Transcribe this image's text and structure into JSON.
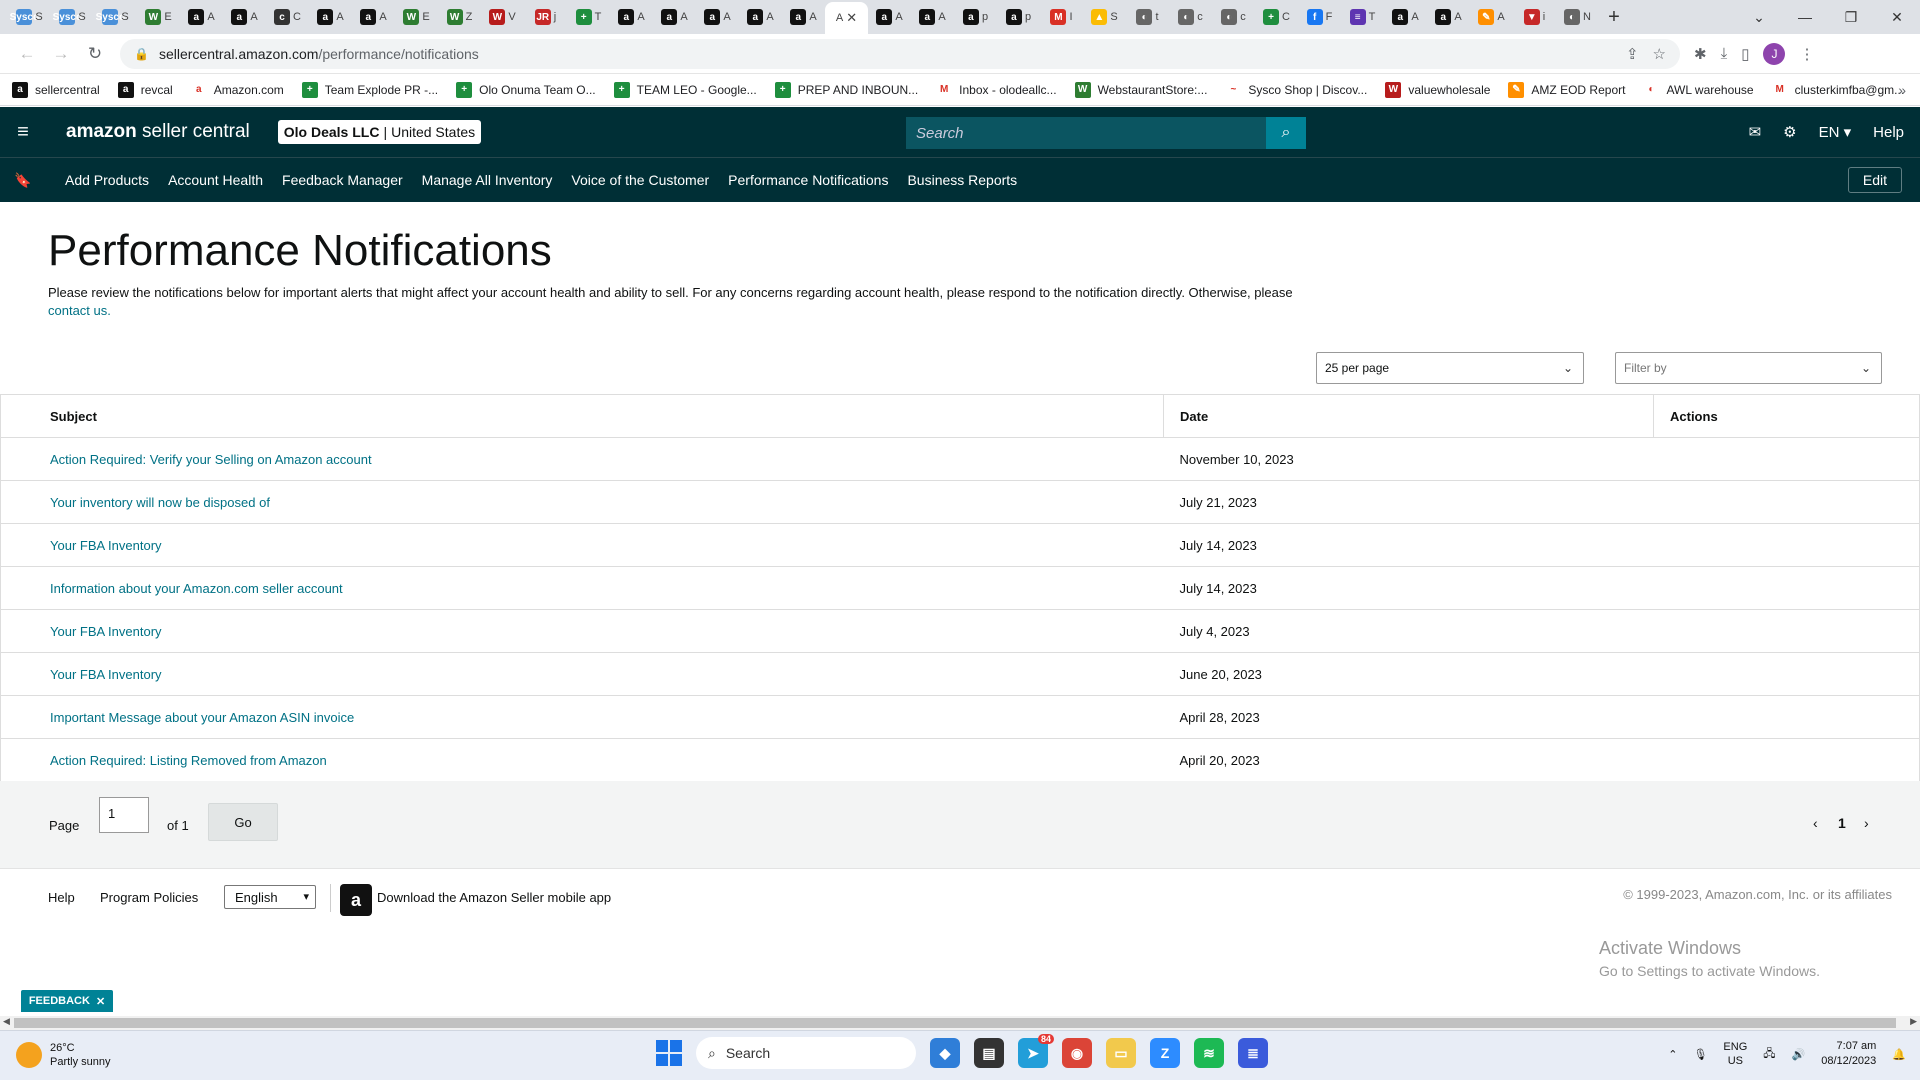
{
  "browser": {
    "tabs": [
      {
        "label": "S",
        "color": "#4a90d9",
        "icon_text": "Sysco"
      },
      {
        "label": "S",
        "color": "#4a90d9",
        "icon_text": "Sysco"
      },
      {
        "label": "S",
        "color": "#4a90d9",
        "icon_text": "Sysco"
      },
      {
        "label": "E",
        "color": "#2e7d32",
        "icon_text": "W"
      },
      {
        "label": "A",
        "color": "#111111",
        "icon_text": "a"
      },
      {
        "label": "A",
        "color": "#111111",
        "icon_text": "a"
      },
      {
        "label": "C",
        "color": "#333333",
        "icon_text": "c"
      },
      {
        "label": "A",
        "color": "#111111",
        "icon_text": "a"
      },
      {
        "label": "A",
        "color": "#111111",
        "icon_text": "a"
      },
      {
        "label": "E",
        "color": "#2e7d32",
        "icon_text": "W"
      },
      {
        "label": "Z",
        "color": "#2e7d32",
        "icon_text": "W"
      },
      {
        "label": "V",
        "color": "#b71c1c",
        "icon_text": "W"
      },
      {
        "label": "j",
        "color": "#c62828",
        "icon_text": "JR"
      },
      {
        "label": "T",
        "color": "#1e8e3e",
        "icon_text": "+"
      },
      {
        "label": "A",
        "color": "#111111",
        "icon_text": "a"
      },
      {
        "label": "A",
        "color": "#111111",
        "icon_text": "a"
      },
      {
        "label": "A",
        "color": "#111111",
        "icon_text": "a"
      },
      {
        "label": "A",
        "color": "#111111",
        "icon_text": "a"
      },
      {
        "label": "A",
        "color": "#111111",
        "icon_text": "a"
      }
    ],
    "active_tab_label": "A",
    "tabs_after": [
      {
        "label": "A",
        "color": "#111111",
        "icon_text": "a"
      },
      {
        "label": "A",
        "color": "#111111",
        "icon_text": "a"
      },
      {
        "label": "p",
        "color": "#111111",
        "icon_text": "a"
      },
      {
        "label": "p",
        "color": "#111111",
        "icon_text": "a"
      },
      {
        "label": "I",
        "color": "#d93025",
        "icon_text": "M"
      },
      {
        "label": "S",
        "color": "#fbbc04",
        "icon_text": "▲"
      },
      {
        "label": "t",
        "color": "#666666",
        "icon_text": "◐"
      },
      {
        "label": "c",
        "color": "#666666",
        "icon_text": "◐"
      },
      {
        "label": "c",
        "color": "#666666",
        "icon_text": "◐"
      },
      {
        "label": "C",
        "color": "#1e8e3e",
        "icon_text": "+"
      },
      {
        "label": "F",
        "color": "#1877f2",
        "icon_text": "f"
      },
      {
        "label": "T",
        "color": "#5e35b1",
        "icon_text": "≡"
      },
      {
        "label": "A",
        "color": "#111111",
        "icon_text": "a"
      },
      {
        "label": "A",
        "color": "#111111",
        "icon_text": "a"
      },
      {
        "label": "A",
        "color": "#ff8f00",
        "icon_text": "✎"
      },
      {
        "label": "i",
        "color": "#c62828",
        "icon_text": "▼"
      },
      {
        "label": "N",
        "color": "#666666",
        "icon_text": "◐"
      }
    ],
    "new_tab": "+",
    "url_domain": "sellercentral.amazon.com",
    "url_path": "/performance/notifications",
    "bookmarks": [
      {
        "label": "sellercentral",
        "color": "#111111",
        "icon_text": "a"
      },
      {
        "label": "revcal",
        "color": "#111111",
        "icon_text": "a"
      },
      {
        "label": "Amazon.com",
        "color": "#ffffff",
        "icon_text": "a"
      },
      {
        "label": "Team Explode PR -...",
        "color": "#1e8e3e",
        "icon_text": "+"
      },
      {
        "label": "Olo Onuma Team O...",
        "color": "#1e8e3e",
        "icon_text": "+"
      },
      {
        "label": "TEAM LEO - Google...",
        "color": "#1e8e3e",
        "icon_text": "+"
      },
      {
        "label": "PREP AND INBOUN...",
        "color": "#1e8e3e",
        "icon_text": "+"
      },
      {
        "label": "Inbox - olodeallc...",
        "color": "#ffffff",
        "icon_text": "M"
      },
      {
        "label": "WebstaurantStore:...",
        "color": "#2e7d32",
        "icon_text": "W"
      },
      {
        "label": "Sysco Shop | Discov...",
        "color": "#ffffff",
        "icon_text": "~"
      },
      {
        "label": "valuewholesale",
        "color": "#b71c1c",
        "icon_text": "W"
      },
      {
        "label": "AMZ EOD Report",
        "color": "#ff8f00",
        "icon_text": "✎"
      },
      {
        "label": "AWL warehouse",
        "color": "#ffffff",
        "icon_text": "◐"
      },
      {
        "label": "clusterkimfba@gm...",
        "color": "#ffffff",
        "icon_text": "M"
      }
    ],
    "bookmarks_more": "»",
    "profile_initial": "J"
  },
  "header": {
    "logo_brand": "amazon",
    "logo_product": "seller central",
    "account_name": "Olo Deals LLC",
    "account_sep": "|",
    "marketplace": "United States",
    "search_placeholder": "Search",
    "language": "EN",
    "help": "Help"
  },
  "nav": {
    "items": [
      "Add Products",
      "Account Health",
      "Feedback Manager",
      "Manage All Inventory",
      "Voice of the Customer",
      "Performance Notifications",
      "Business Reports"
    ],
    "edit": "Edit"
  },
  "page": {
    "title": "Performance Notifications",
    "intro": "Please review the notifications below for important alerts that might affect your account health and ability to sell. For any concerns regarding account health, please respond to the notification directly. Otherwise, please",
    "contact_link": "contact us.",
    "per_page": "25 per page",
    "filter_placeholder": "Filter by"
  },
  "table": {
    "columns": [
      "Subject",
      "Date",
      "Actions"
    ],
    "rows": [
      {
        "subject": "Action Required: Verify your Selling on Amazon account",
        "date": "November 10, 2023"
      },
      {
        "subject": "Your inventory will now be disposed of",
        "date": "July 21, 2023"
      },
      {
        "subject": "Your FBA Inventory",
        "date": "July 14, 2023"
      },
      {
        "subject": "Information about your Amazon.com seller account",
        "date": "July 14, 2023"
      },
      {
        "subject": "Your FBA Inventory",
        "date": "July 4, 2023"
      },
      {
        "subject": "Your FBA Inventory",
        "date": "June 20, 2023"
      },
      {
        "subject": "Important Message about your Amazon ASIN invoice",
        "date": "April 28, 2023"
      },
      {
        "subject": "Action Required: Listing Removed from Amazon",
        "date": "April 20, 2023"
      }
    ]
  },
  "pager": {
    "label": "Page",
    "value": "1",
    "of": "of 1",
    "go": "Go",
    "current": "1"
  },
  "footer": {
    "help": "Help",
    "policies": "Program Policies",
    "language": "English",
    "app_text": "Download the Amazon Seller mobile app",
    "copyright": "© 1999-2023, Amazon.com, Inc. or its affiliates",
    "activate_title": "Activate Windows",
    "activate_sub": "Go to Settings to activate Windows."
  },
  "feedback": "FEEDBACK",
  "taskbar": {
    "temp": "26°C",
    "weather": "Partly sunny",
    "search": "Search",
    "badge": "84",
    "lang_top": "ENG",
    "lang_bottom": "US",
    "time": "7:07 am",
    "date": "08/12/2023"
  }
}
